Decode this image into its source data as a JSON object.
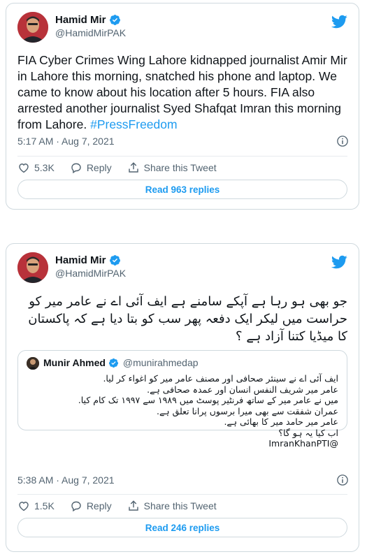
{
  "tweets": [
    {
      "author_name": "Hamid Mir",
      "author_handle": "@HamidMirPAK",
      "text_main": "FIA Cyber Crimes Wing Lahore kidnapped journalist Amir Mir in Lahore this morning, snatched his phone and laptop. We came to know about his location after 5 hours. FIA also arrested another journalist Syed Shafqat Imran this morning from Lahore.",
      "hashtag": "#PressFreedom",
      "timestamp": "5:17 AM · Aug 7, 2021",
      "likes": "5.3K",
      "reply_label": "Reply",
      "share_label": "Share this Tweet",
      "replies_button": "Read 963 replies"
    },
    {
      "author_name": "Hamid Mir",
      "author_handle": "@HamidMirPAK",
      "text": "جو بھی ہو رہا ہے آپکے سامنے ہے ایف آئی اے نے عامر میر کو حراست میں لیکر ایک دفعہ پھر سب کو بتا دیا ہے کہ پاکستان کا میڈیا کتنا آزاد ہے ؟",
      "quote": {
        "author_name": "Munir Ahmed",
        "author_handle": "@munirahmedap",
        "lines": [
          "ایف آئی اے نے سینئر صحافی اور مصنف عامر میر  کو اغواء کر لیا.",
          "عامر میر شریف النفس انسان اور عمدہ صحافی ہے.",
          "میں نے عامر میر کے ساتھ فرنٹیر پوسٹ میں ۱۹۸۹ سے ۱۹۹۷ تک کام کیا.",
          "عمران شفقت سے بھی میرا برسوں پرانا تعلق ہے.",
          "عامر میر حامد میر کا بھائی ہے.",
          "اب کیا یہ ہو گا؟",
          "@ImranKhanPTI"
        ]
      },
      "timestamp": "5:38 AM · Aug 7, 2021",
      "likes": "1.5K",
      "reply_label": "Reply",
      "share_label": "Share this Tweet",
      "replies_button": "Read 246 replies"
    }
  ],
  "colors": {
    "accent": "#1d9bf0",
    "muted": "#536471",
    "border": "#cfd9de"
  }
}
